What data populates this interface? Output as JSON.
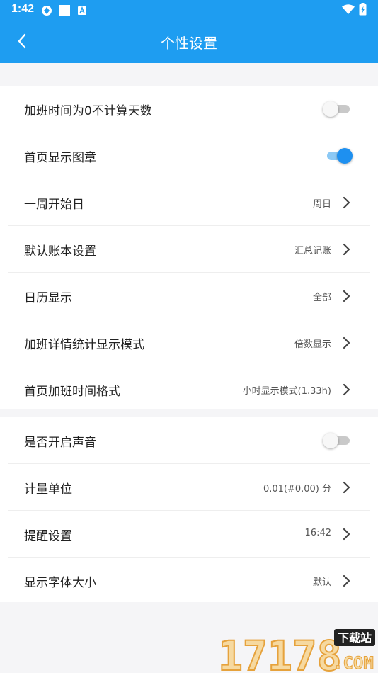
{
  "status": {
    "time": "1:42"
  },
  "appbar": {
    "title": "个性设置"
  },
  "section1": {
    "rows": [
      {
        "label": "加班时间为0不计算天数",
        "type": "toggle",
        "on": false
      },
      {
        "label": "首页显示图章",
        "type": "toggle",
        "on": true
      },
      {
        "label": "一周开始日",
        "value": "周日"
      },
      {
        "label": "默认账本设置",
        "value": "汇总记账"
      },
      {
        "label": "日历显示",
        "value": "全部"
      },
      {
        "label": "加班详情统计显示模式",
        "value": "倍数显示"
      },
      {
        "label": "首页加班时间格式",
        "value": "小时显示模式(1.33h)"
      }
    ]
  },
  "section2": {
    "rows": [
      {
        "label": "是否开启声音",
        "type": "toggle",
        "on": false
      },
      {
        "label": "计量单位",
        "value": "0.01(#0.00) 分"
      },
      {
        "label": "提醒设置",
        "value": "16:42"
      },
      {
        "label": "显示字体大小",
        "value": "默认"
      }
    ]
  },
  "watermark": {
    "number": "17178",
    "tag": "下载站",
    "domain": ".COM"
  },
  "colors": {
    "primary": "#1e9df1",
    "toggle_on": "#1e90f0"
  }
}
